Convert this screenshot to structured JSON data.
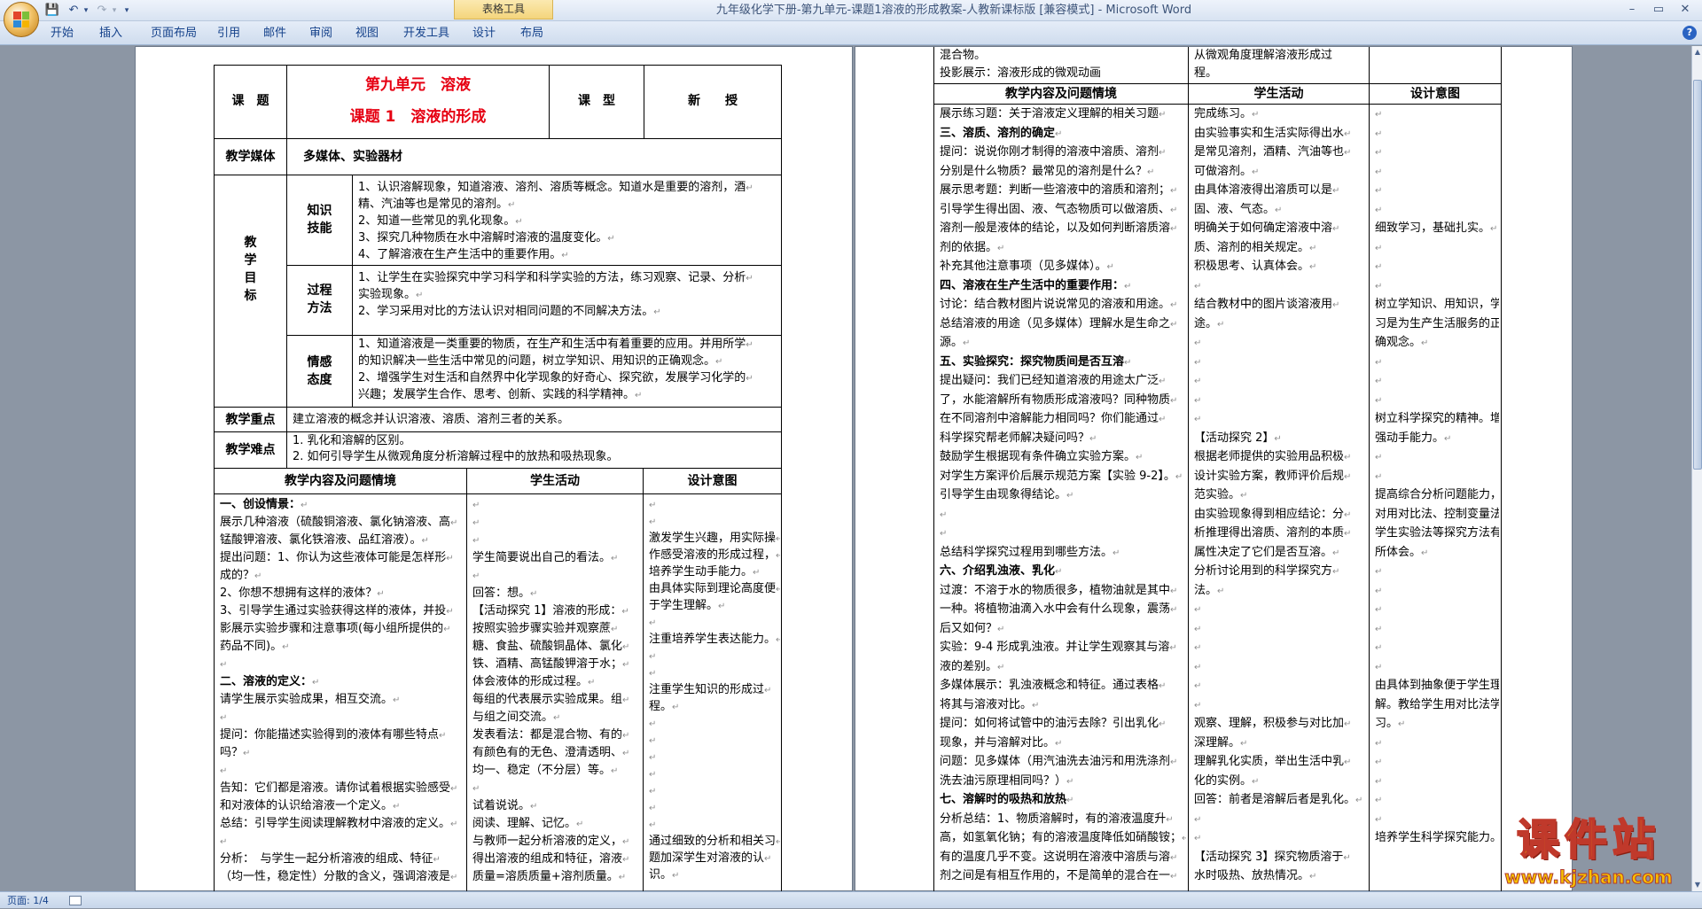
{
  "window": {
    "title": "九年级化学下册-第九单元-课题1溶液的形成教案-人教新课标版 [兼容模式] - Microsoft Word",
    "context_tab_group": "表格工具",
    "min_glyph": "–",
    "max_glyph": "▭",
    "close_glyph": "✕"
  },
  "qat": {
    "save": "💾",
    "undo": "↶",
    "redo": "↷",
    "dropdown": "▾"
  },
  "ribbon": {
    "tabs": [
      "开始",
      "插入",
      "页面布局",
      "引用",
      "邮件",
      "审阅",
      "视图",
      "开发工具",
      "设计",
      "布局"
    ],
    "help": "?"
  },
  "status": {
    "page": "页面: 1/4"
  },
  "watermark": {
    "main": "课件站",
    "url": "www.kjzhan.com"
  },
  "colors": {
    "accent_red": "#e60012",
    "watermark_gold": "#f7c100"
  },
  "page1": {
    "course_label": "课　题",
    "title_unit": "第九单元　溶液",
    "title_lesson": "课题 1　溶液的形成",
    "type_label": "课　型",
    "type_value": "新　　授",
    "media_label": "教学媒体",
    "media_value": "多媒体、实验器材",
    "goals_label": [
      "教",
      "学",
      "目",
      "标"
    ],
    "knowledge_label": [
      "知识",
      "技能"
    ],
    "knowledge": [
      "1、认识溶解现象，知道溶液、溶剂、溶质等概念。知道水是重要的溶剂，酒",
      "精、汽油等也是常见的溶剂。",
      "2、知道一些常见的乳化现象。",
      "3、探究几种物质在水中溶解时溶液的温度变化。",
      "4、了解溶液在生产生活中的重要作用。"
    ],
    "process_label": [
      "过程",
      "方法"
    ],
    "process": [
      "1、让学生在实验探究中学习科学和科学实验的方法，练习观察、记录、分析",
      "实验现象。",
      "2、学习采用对比的方法认识对相同问题的不同解决方法。"
    ],
    "emotion_label": [
      "情感",
      "态度"
    ],
    "emotion": [
      "1、知道溶液是一类重要的物质，在生产和生活中有着重要的应用。并用所学",
      "的知识解决一些生活中常见的问题，树立学知识、用知识的正确观念。",
      "2、增强学生对生活和自然界中化学现象的好奇心、探究欲，发展学习化学的",
      "兴趣；发展学生合作、思考、创新、实践的科学精神。"
    ],
    "key_label": "教学重点",
    "key_value": "建立溶液的概念并认识溶液、溶质、溶剂三者的关系。",
    "diff_label": "教学难点",
    "diff_value": [
      "1. 乳化和溶解的区别。",
      "2. 如何引导学生从微观角度分析溶解过程中的放热和吸热现象。"
    ],
    "col_content": "教学内容及问题情境",
    "col_student": "学生活动",
    "col_design": "设计意图",
    "content": [
      "一、创设情景：",
      "展示几种溶液（硫酸铜溶液、氯化钠溶液、高",
      "锰酸钾溶液、氯化铁溶液、品红溶液）。",
      "提出问题：1、你认为这些液体可能是怎样形",
      "成的？",
      "2、你想不想拥有这样的液体？",
      "3、引导学生通过实验获得这样的液体，并投",
      "影展示实验步骤和注意事项(每小组所提供的",
      "药品不同)。",
      "",
      "二、溶液的定义：",
      "请学生展示实验成果，相互交流。",
      "",
      "提问：你能描述实验得到的液体有哪些特点",
      "吗？",
      "",
      "告知：它们都是溶液。请你试着根据实验感受",
      "和对液体的认识给溶液一个定义。",
      "总结：引导学生阅读理解教材中溶液的定义。",
      "",
      "分析：　与学生一起分析溶液的组成、特征",
      "（均一性，稳定性）分散的含义，强调溶液是"
    ],
    "student": [
      "",
      "",
      "",
      "学生简要说出自己的看法。",
      "",
      "回答：想。",
      "【活动探究 1】溶液的形成：",
      "按照实验步骤实验并观察蔗",
      "糖、食盐、硫酸铜晶体、氯化",
      "铁、酒精、高锰酸钾溶于水；",
      "体会液体的形成过程。",
      "每组的代表展示实验成果。组",
      "与组之间交流。",
      "发表看法：都是混合物、有的",
      "有颜色有的无色、澄清透明、",
      "均一、稳定（不分层）等。",
      "",
      "试着说说。",
      "阅读、理解、记忆。",
      "与教师一起分析溶液的定义，",
      "得出溶液的组成和特征，溶液",
      "质量=溶质质量+溶剂质量。"
    ],
    "design": [
      "",
      "",
      "激发学生兴趣，用实际操",
      "作感受溶液的形成过程，",
      "培养学生动手能力。",
      "由具体实际到理论高度便",
      "于学生理解。",
      "",
      "注重培养学生表达能力。",
      "",
      "",
      "注重学生知识的形成过",
      "程。",
      "",
      "",
      "",
      "",
      "",
      "",
      "",
      "通过细致的分析和相关习",
      "题加深学生对溶液的认",
      "识。"
    ]
  },
  "page2": {
    "top_left": [
      "混合物。",
      "投影展示：溶液形成的微观动画"
    ],
    "top_mid": [
      "从微观角度理解溶液形成过",
      "程。"
    ],
    "col_content": "教学内容及问题情境",
    "col_student": "学生活动",
    "col_design": "设计意图",
    "content": [
      "展示练习题：关于溶液定义理解的相关习题",
      "三、溶质、溶剂的确定",
      "提问：说说你刚才制得的溶液中溶质、溶剂",
      "分别是什么物质？最常见的溶剂是什么？",
      "展示思考题：判断一些溶液中的溶质和溶剂；",
      "引导学生得出固、液、气态物质可以做溶质、",
      "溶剂一般是液体的结论，以及如何判断溶质溶",
      "剂的依据。",
      "补充其他注意事项（见多媒体）。",
      "四、溶液在生产生活中的重要作用：",
      "讨论：结合教材图片说说常见的溶液和用途。",
      "总结溶液的用途（见多媒体）理解水是生命之",
      "源。",
      "五、实验探究：探究物质间是否互溶",
      "提出疑问：我们已经知道溶液的用途太广泛",
      "了，水能溶解所有物质形成溶液吗？同种物质",
      "在不同溶剂中溶解能力相同吗？你们能通过",
      "科学探究帮老师解决疑问吗？",
      "鼓励学生根据现有条件确立实验方案。",
      "对学生方案评价后展示规范方案【实验 9-2】。",
      "引导学生由现象得结论。",
      "",
      "",
      "总结科学探究过程用到哪些方法。",
      "六、介绍乳浊液、乳化",
      "过渡：不溶于水的物质很多，植物油就是其中",
      "一种。将植物油滴入水中会有什么现象，震荡",
      "后又如何？",
      "实验：9-4 形成乳浊液。并让学生观察其与溶",
      "液的差别。",
      "多媒体展示：乳浊液概念和特征。通过表格",
      "将其与溶液对比。",
      "提问：如何将试管中的油污去除？引出乳化",
      "现象，并与溶解对比。",
      "问题：见多媒体（用汽油洗去油污和用洗涤剂",
      "洗去油污原理相同吗？）",
      "七、溶解时的吸热和放热",
      "分析总结：1、物质溶解时，有的溶液温度升",
      "高，如氢氧化钠；有的溶液温度降低如硝酸铵；",
      "有的温度几乎不变。这说明在溶液中溶质与溶",
      "剂之间是有相互作用的，不是简单的混合在一"
    ],
    "student": [
      "完成练习。",
      "由实验事实和生活实际得出水",
      "是常见溶剂，酒精、汽油等也",
      "可做溶剂。",
      "由具体溶液得出溶质可以是",
      "固、液、气态。",
      "明确关于如何确定溶液中溶",
      "质、溶剂的相关规定。",
      "积极思考、认真体会。",
      "",
      "结合教材中的图片谈溶液用",
      "途。",
      "",
      "",
      "",
      "",
      "",
      "【活动探究 2】",
      "根据老师提供的实验用品积极",
      "设计实验方案，教师评价后规",
      "范实验。",
      "由实验现象得到相应结论：分",
      "析推理得出溶质、溶剂的本质",
      "属性决定了它们是否互溶。",
      "分析讨论用到的科学探究方",
      "法。",
      "",
      "",
      "",
      "",
      "",
      "",
      "观察、理解，积极参与对比加",
      "深理解。",
      "理解乳化实质，举出生活中乳",
      "化的实例。",
      "回答：前者是溶解后者是乳化。",
      "",
      "",
      "【活动探究 3】探究物质溶于",
      "水时吸热、放热情况。"
    ],
    "design": [
      "",
      "",
      "",
      "",
      "",
      "",
      "细致学习，基础扎实。",
      "",
      "",
      "",
      "树立学知识、用知识，学",
      "习是为生产生活服务的正",
      "确观念。",
      "",
      "",
      "",
      "树立科学探究的精神。增",
      "强动手能力。",
      "",
      "",
      "提高综合分析问题能力，",
      "对用对比法、控制变量法、",
      "学生实验法等探究方法有",
      "所体会。",
      "",
      "",
      "",
      "",
      "",
      "",
      "由具体到抽象便于学生理",
      "解。教给学生用对比法学",
      "习。",
      "",
      "",
      "",
      "",
      "",
      "培养学生科学探究能力。"
    ]
  },
  "para_mark": "↵"
}
